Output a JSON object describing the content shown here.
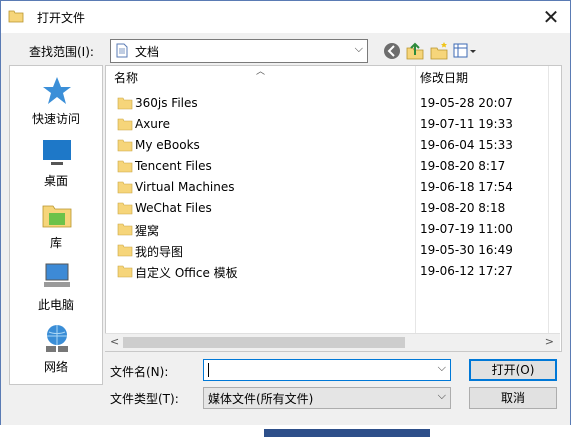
{
  "window": {
    "title": "打开文件",
    "close_glyph": "✕"
  },
  "lookin": {
    "label": "查找范围(I):",
    "value": "文档"
  },
  "toolbar": {
    "icons": [
      "back-icon",
      "up-folder-icon",
      "new-folder-icon",
      "view-menu-icon"
    ]
  },
  "places": [
    {
      "label": "快速访问",
      "icon": "star-icon"
    },
    {
      "label": "桌面",
      "icon": "desktop-icon"
    },
    {
      "label": "库",
      "icon": "library-icon"
    },
    {
      "label": "此电脑",
      "icon": "computer-icon"
    },
    {
      "label": "网络",
      "icon": "network-icon"
    }
  ],
  "columns": {
    "name": "名称",
    "date": "修改日期"
  },
  "files": [
    {
      "name": "360js Files",
      "date": "19-05-28 20:07"
    },
    {
      "name": "Axure",
      "date": "19-07-11 19:33"
    },
    {
      "name": "My eBooks",
      "date": "19-06-04 15:33"
    },
    {
      "name": "Tencent Files",
      "date": "19-08-20 8:17"
    },
    {
      "name": "Virtual Machines",
      "date": "19-06-18 17:54"
    },
    {
      "name": "WeChat Files",
      "date": "19-08-20 8:18"
    },
    {
      "name": "猩窝",
      "date": "19-07-19 11:00"
    },
    {
      "name": "我的导图",
      "date": "19-05-30 16:49"
    },
    {
      "name": "自定义 Office 模板",
      "date": "19-06-12 17:27"
    }
  ],
  "form": {
    "filename_label": "文件名(N):",
    "filename_value": "",
    "filetype_label": "文件类型(T):",
    "filetype_value": "媒体文件(所有文件)"
  },
  "buttons": {
    "open": "打开(O)",
    "cancel": "取消"
  },
  "colors": {
    "folder": "#f6d57a",
    "accent": "#0078d7",
    "border": "#5a7bb4"
  }
}
